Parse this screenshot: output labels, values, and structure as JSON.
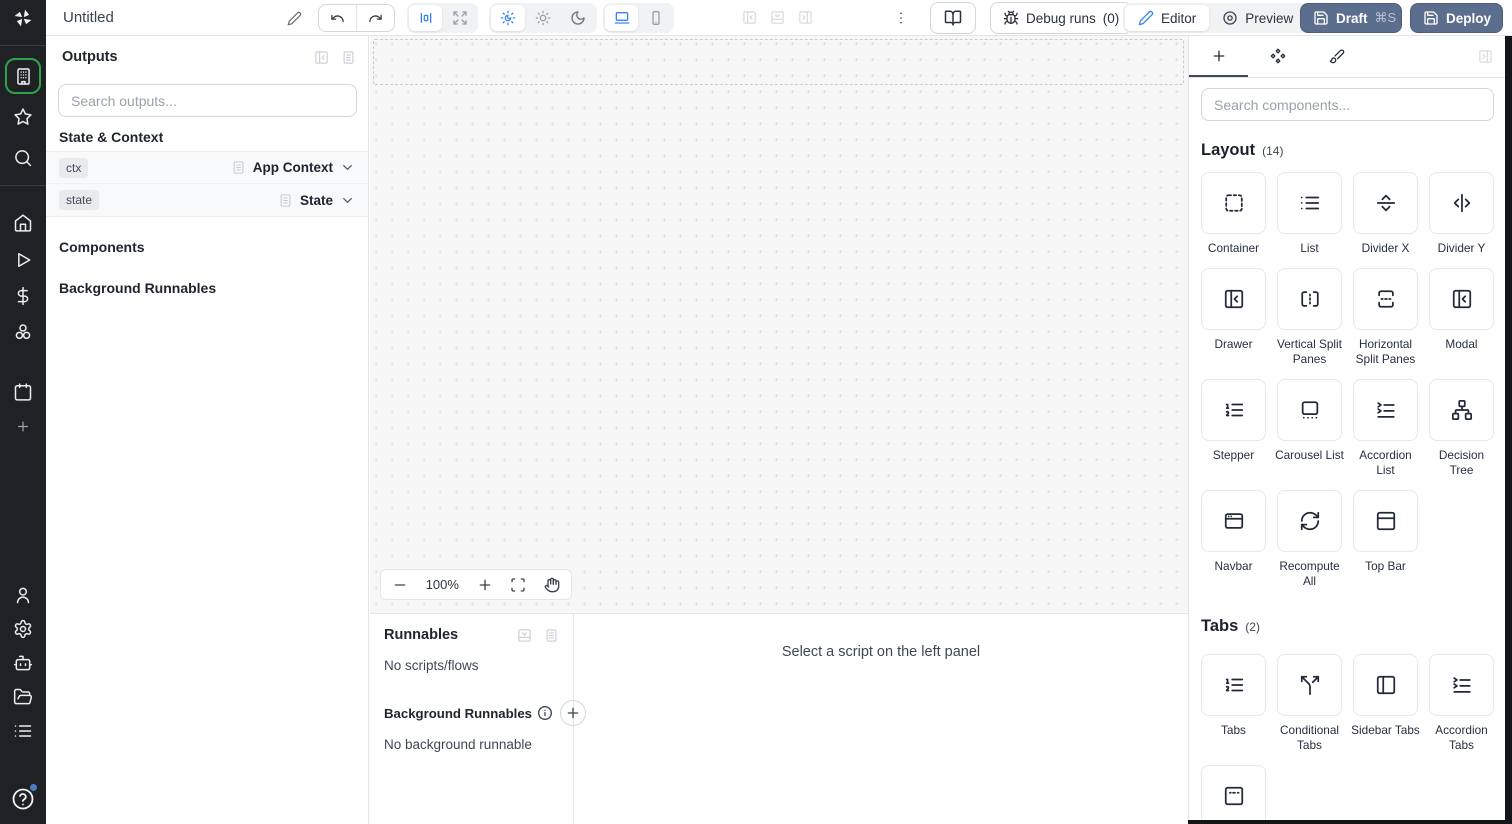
{
  "app": {
    "accent_blue": "#3b82f6",
    "brand_green": "#2fa24a",
    "deploy_button_color": "#5c6e8d"
  },
  "topbar": {
    "title": "Untitled",
    "debug_runs_label": "Debug runs",
    "debug_runs_count": "(0)",
    "editor_label": "Editor",
    "preview_label": "Preview",
    "draft_label": "Draft",
    "draft_shortcut": "⌘S",
    "deploy_label": "Deploy"
  },
  "sidebar": {
    "top_icons": [
      "building",
      "star",
      "search",
      "home",
      "play",
      "dollar",
      "cluster",
      "calendar",
      "plus"
    ],
    "bottom_icons": [
      "user",
      "settings",
      "bot",
      "folder-open",
      "list-rows",
      "help"
    ],
    "active_icon": "building",
    "logo_icon": "windmill-logo"
  },
  "outputs_panel": {
    "title": "Outputs",
    "search_placeholder": "Search outputs...",
    "state_context_header": "State & Context",
    "rows": [
      {
        "badge": "ctx",
        "label": "App Context"
      },
      {
        "badge": "state",
        "label": "State"
      }
    ],
    "components_header": "Components",
    "background_runnables_header": "Background Runnables"
  },
  "canvas": {
    "zoom_level": "100%"
  },
  "runnables_panel": {
    "title": "Runnables",
    "empty_text": "No scripts/flows",
    "background_title": "Background Runnables",
    "background_empty_text": "No background runnable",
    "hint_text": "Select a script on the left panel"
  },
  "components_panel": {
    "search_placeholder": "Search components...",
    "sections": [
      {
        "title": "Layout",
        "count": "(14)",
        "items": [
          {
            "label": "Container",
            "icon": "container"
          },
          {
            "label": "List",
            "icon": "list"
          },
          {
            "label": "Divider X",
            "icon": "divider-x"
          },
          {
            "label": "Divider Y",
            "icon": "divider-y"
          },
          {
            "label": "Drawer",
            "icon": "drawer"
          },
          {
            "label": "Vertical Split Panes",
            "icon": "vsplit"
          },
          {
            "label": "Horizontal Split Panes",
            "icon": "hsplit"
          },
          {
            "label": "Modal",
            "icon": "drawer"
          },
          {
            "label": "Stepper",
            "icon": "list-ordered"
          },
          {
            "label": "Carousel List",
            "icon": "carousel"
          },
          {
            "label": "Accordion List",
            "icon": "accordion"
          },
          {
            "label": "Decision Tree",
            "icon": "network"
          },
          {
            "label": "Navbar",
            "icon": "navbar"
          },
          {
            "label": "Recompute All",
            "icon": "refresh"
          },
          {
            "label": "Top Bar",
            "icon": "panel-top"
          }
        ]
      },
      {
        "title": "Tabs",
        "count": "(2)",
        "items": [
          {
            "label": "Tabs",
            "icon": "list-ordered"
          },
          {
            "label": "Conditional Tabs",
            "icon": "split"
          },
          {
            "label": "Sidebar Tabs",
            "icon": "panel-left"
          },
          {
            "label": "Accordion Tabs",
            "icon": "accordion"
          },
          {
            "label": "",
            "icon": "invisible-tabs"
          }
        ]
      }
    ]
  }
}
